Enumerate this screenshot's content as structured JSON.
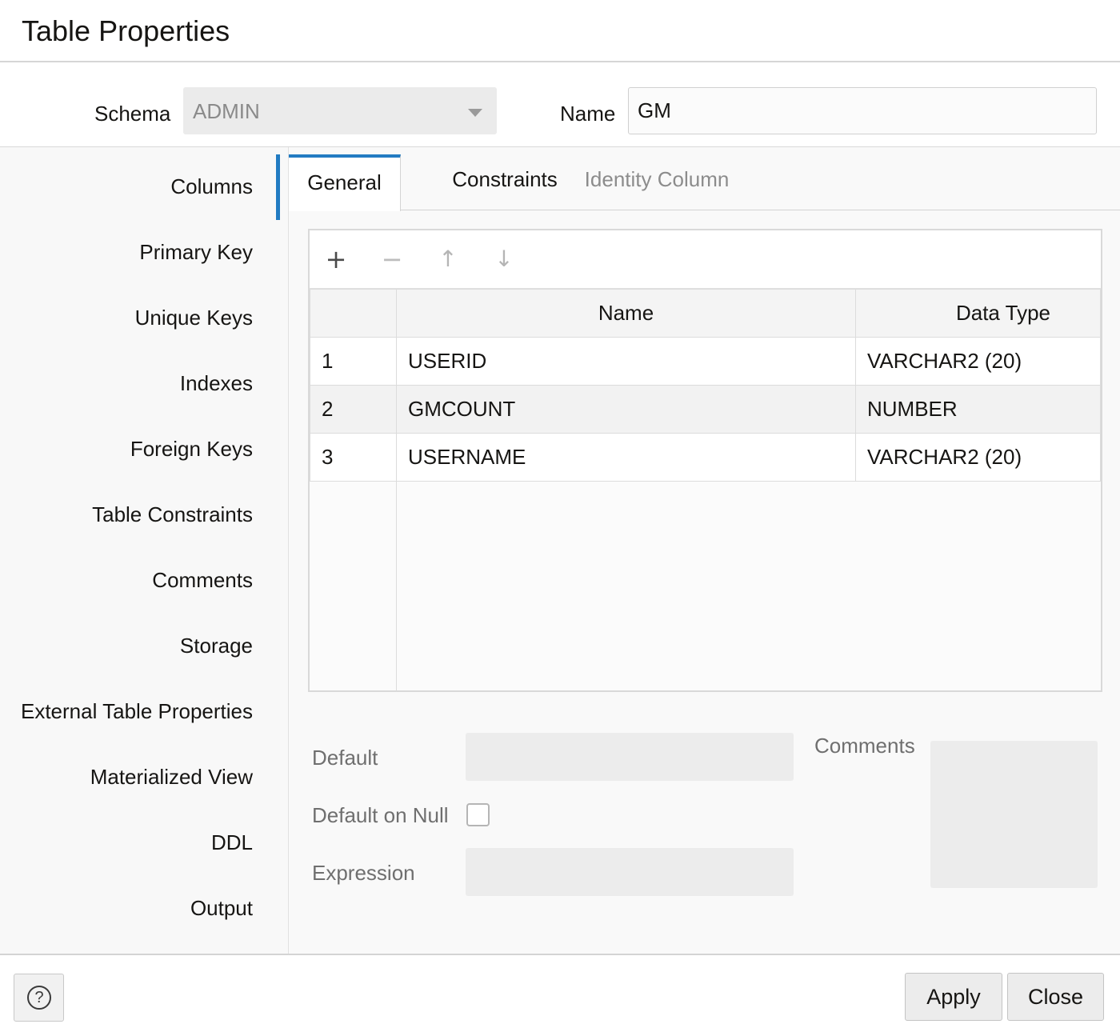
{
  "dialog": {
    "title": "Table Properties"
  },
  "header": {
    "schema_label": "Schema",
    "schema_value": "ADMIN",
    "name_label": "Name",
    "name_value": "GM"
  },
  "sidebar": {
    "items": [
      {
        "label": "Columns",
        "active": true
      },
      {
        "label": "Primary Key"
      },
      {
        "label": "Unique Keys"
      },
      {
        "label": "Indexes"
      },
      {
        "label": "Foreign Keys"
      },
      {
        "label": "Table Constraints"
      },
      {
        "label": "Comments"
      },
      {
        "label": "Storage"
      },
      {
        "label": "External Table Properties"
      },
      {
        "label": "Materialized View"
      },
      {
        "label": "DDL"
      },
      {
        "label": "Output"
      }
    ]
  },
  "tabs": [
    {
      "label": "General",
      "active": true
    },
    {
      "label": "Constraints"
    },
    {
      "label": "Identity Column",
      "disabled": true
    }
  ],
  "toolbar": {
    "add_icon": "plus-icon",
    "remove_icon": "minus-icon",
    "up_icon": "arrow-up-icon",
    "down_icon": "arrow-down-icon"
  },
  "columns_table": {
    "headers": [
      "",
      "Name",
      "Data Type"
    ],
    "rows": [
      {
        "num": "1",
        "name": "USERID",
        "type": "VARCHAR2 (20)"
      },
      {
        "num": "2",
        "name": "GMCOUNT",
        "type": "NUMBER",
        "selected": true
      },
      {
        "num": "3",
        "name": "USERNAME",
        "type": "VARCHAR2 (20)"
      }
    ]
  },
  "details": {
    "default_label": "Default",
    "default_value": "",
    "default_on_null_label": "Default on Null",
    "default_on_null_checked": false,
    "expression_label": "Expression",
    "expression_value": "",
    "comments_label": "Comments",
    "comments_value": ""
  },
  "footer": {
    "help_icon": "help-circle-icon",
    "help_glyph": "?",
    "apply_label": "Apply",
    "close_label": "Close"
  },
  "colors": {
    "accent": "#227bc2",
    "selected_row": "#f2f2f2"
  }
}
